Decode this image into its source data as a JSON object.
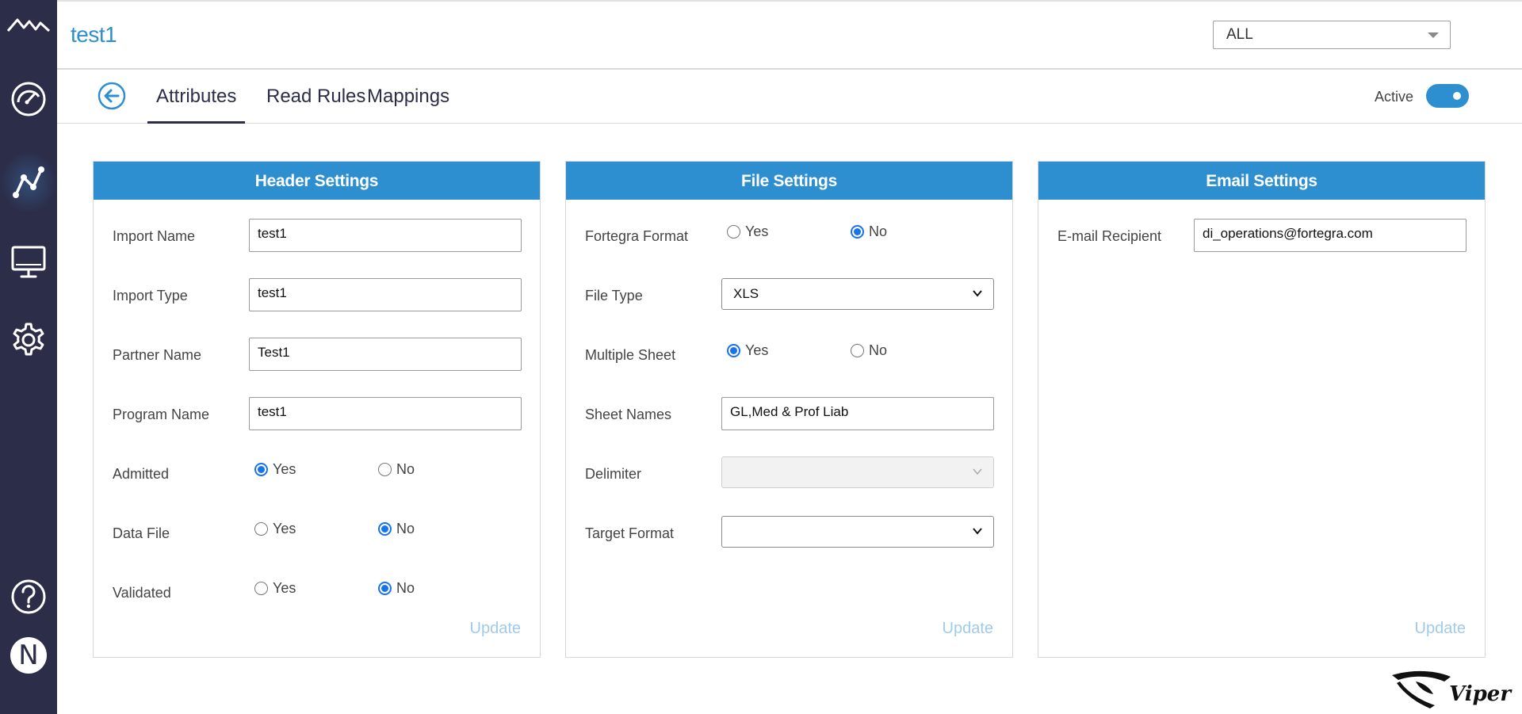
{
  "app": {
    "title": "test1",
    "env_select_value": "ALL"
  },
  "sidebar": {
    "items": [
      {
        "icon": "mountain-logo-icon"
      },
      {
        "icon": "dashboard-gauge-icon"
      },
      {
        "icon": "graph-nodes-icon",
        "active": true
      },
      {
        "icon": "monitor-icon"
      },
      {
        "icon": "settings-gear-icon"
      },
      {
        "icon": "help-icon"
      },
      {
        "icon": "user-avatar-icon",
        "avatar_letter": "N"
      }
    ]
  },
  "tabs": [
    {
      "label": "Attributes",
      "active": true
    },
    {
      "label": "Read Rules",
      "active": false
    },
    {
      "label": "Mappings",
      "active": false
    }
  ],
  "status": {
    "label": "Active",
    "enabled": true
  },
  "header_settings": {
    "title": "Header Settings",
    "import_name_label": "Import Name",
    "import_name_value": "test1",
    "import_type_label": "Import Type",
    "import_type_value": "test1",
    "partner_name_label": "Partner Name",
    "partner_name_value": "Test1",
    "program_name_label": "Program Name",
    "program_name_value": "test1",
    "admitted_label": "Admitted",
    "data_file_label": "Data File",
    "validated_label": "Validated",
    "yes_label": "Yes",
    "no_label": "No",
    "admitted_value": "Yes",
    "data_file_value": "No",
    "validated_value": "No",
    "update_label": "Update"
  },
  "file_settings": {
    "title": "File Settings",
    "fortegra_format_label": "Fortegra Format",
    "fortegra_format_value": "No",
    "file_type_label": "File Type",
    "file_type_value": "XLS",
    "multiple_sheet_label": "Multiple Sheet",
    "multiple_sheet_value": "Yes",
    "sheet_names_label": "Sheet Names",
    "sheet_names_value": "GL,Med & Prof Liab",
    "delimiter_label": "Delimiter",
    "delimiter_value": "",
    "target_format_label": "Target Format",
    "target_format_value": "",
    "yes_label": "Yes",
    "no_label": "No",
    "update_label": "Update"
  },
  "email_settings": {
    "title": "Email Settings",
    "recipient_label": "E-mail Recipient",
    "recipient_value": "di_operations@fortegra.com",
    "update_label": "Update"
  },
  "brand": {
    "logo_name": "Viper"
  },
  "colors": {
    "sidebar_bg": "#2c2d48",
    "accent": "#2d8fcf",
    "update_disabled": "#9fcbea"
  }
}
